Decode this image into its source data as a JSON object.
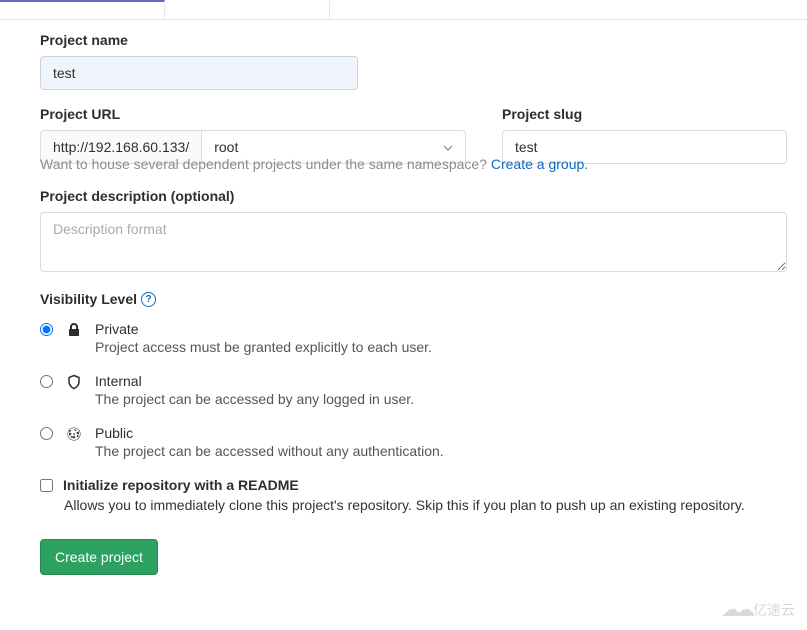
{
  "form": {
    "projectName": {
      "label": "Project name",
      "value": "test"
    },
    "projectUrl": {
      "label": "Project URL",
      "prefix": "http://192.168.60.133/",
      "namespace": "root"
    },
    "projectSlug": {
      "label": "Project slug",
      "value": "test"
    },
    "groupHint": {
      "text": "Want to house several dependent projects under the same namespace? ",
      "linkText": "Create a group."
    },
    "description": {
      "label": "Project description (optional)",
      "placeholder": "Description format"
    },
    "visibility": {
      "label": "Visibility Level",
      "options": [
        {
          "key": "private",
          "title": "Private",
          "desc": "Project access must be granted explicitly to each user.",
          "checked": true
        },
        {
          "key": "internal",
          "title": "Internal",
          "desc": "The project can be accessed by any logged in user.",
          "checked": false
        },
        {
          "key": "public",
          "title": "Public",
          "desc": "The project can be accessed without any authentication.",
          "checked": false
        }
      ]
    },
    "initReadme": {
      "label": "Initialize repository with a README",
      "desc": "Allows you to immediately clone this project's repository. Skip this if you plan to push up an existing repository."
    },
    "submit": "Create project"
  },
  "watermark": "亿速云"
}
